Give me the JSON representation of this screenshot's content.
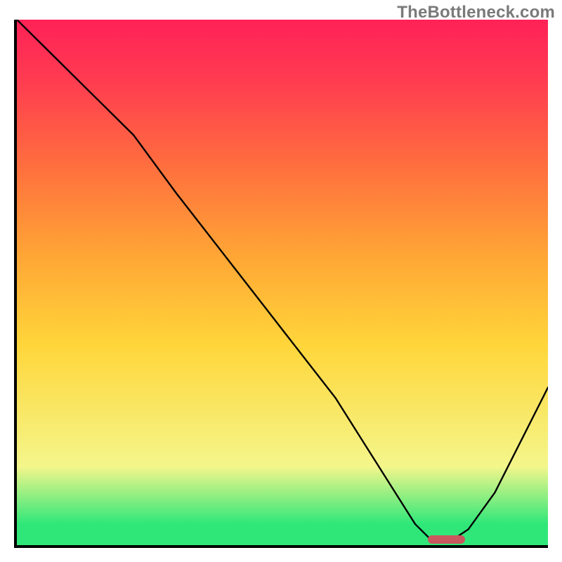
{
  "watermark": "TheBottleneck.com",
  "colors": {
    "axis": "#000000",
    "curve": "#000000",
    "marker": "#c9575e",
    "gradient_stops": [
      "#2fe779",
      "#f4f68b",
      "#ffd63a",
      "#ffa635",
      "#ff6f3e",
      "#ff3d50",
      "#ff2157"
    ]
  },
  "chart_data": {
    "type": "line",
    "title": "",
    "xlabel": "",
    "ylabel": "",
    "xlim": [
      0,
      100
    ],
    "ylim": [
      0,
      100
    ],
    "x": [
      0,
      5,
      15,
      22,
      30,
      40,
      50,
      60,
      70,
      75,
      78,
      82,
      85,
      90,
      95,
      100
    ],
    "values": [
      100,
      95,
      85,
      78,
      67,
      54,
      41,
      28,
      12,
      4,
      1,
      1,
      3,
      10,
      20,
      30
    ],
    "annotations": {
      "optimum_range_x": [
        77,
        84
      ],
      "optimum_value": 1
    }
  }
}
